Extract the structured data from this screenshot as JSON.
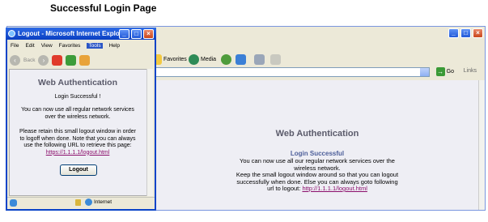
{
  "caption": "Successful Login Page",
  "back_window": {
    "toolbar": {
      "favorites": "Favorites",
      "media": "Media"
    },
    "address": {
      "go_label": "Go",
      "links_label": "Links"
    },
    "page": {
      "title": "Web Authentication",
      "success_heading": "Login Successful",
      "line1": "You can now use all our regular network services over the",
      "line2": "wireless network.",
      "line3": "Keep the small logout window around so that you can logout",
      "line4": "successfully when done. Else you can always goto following",
      "line5_prefix": "url to logout: ",
      "logout_url": "http://1.1.1.1/logout.html"
    }
  },
  "front_window": {
    "title": "Logout - Microsoft Internet Explo...",
    "menu": [
      "File",
      "Edit",
      "View",
      "Favorites",
      "Tools",
      "Help"
    ],
    "back_label": "Back",
    "page": {
      "title": "Web Authentication",
      "success": "Login Successful !",
      "p1_l1": "You can now use all regular network services",
      "p1_l2": "over the wireless network.",
      "p2_l1": "Please retain this small logout window in order",
      "p2_l2": "to logoff when done. Note that you can always",
      "p2_l3": "use the following URL to retrieve this page:",
      "url": "https://1.1.1.1/logout.html",
      "logout_button": "Logout"
    },
    "status": {
      "zone": "Internet"
    }
  },
  "colors": {
    "titlebar": "#0a3fc1",
    "page_bg": "#eeeef4",
    "heading": "#5a5a6a",
    "success_heading": "#4d5f9a",
    "link": "#8b0e6b"
  }
}
